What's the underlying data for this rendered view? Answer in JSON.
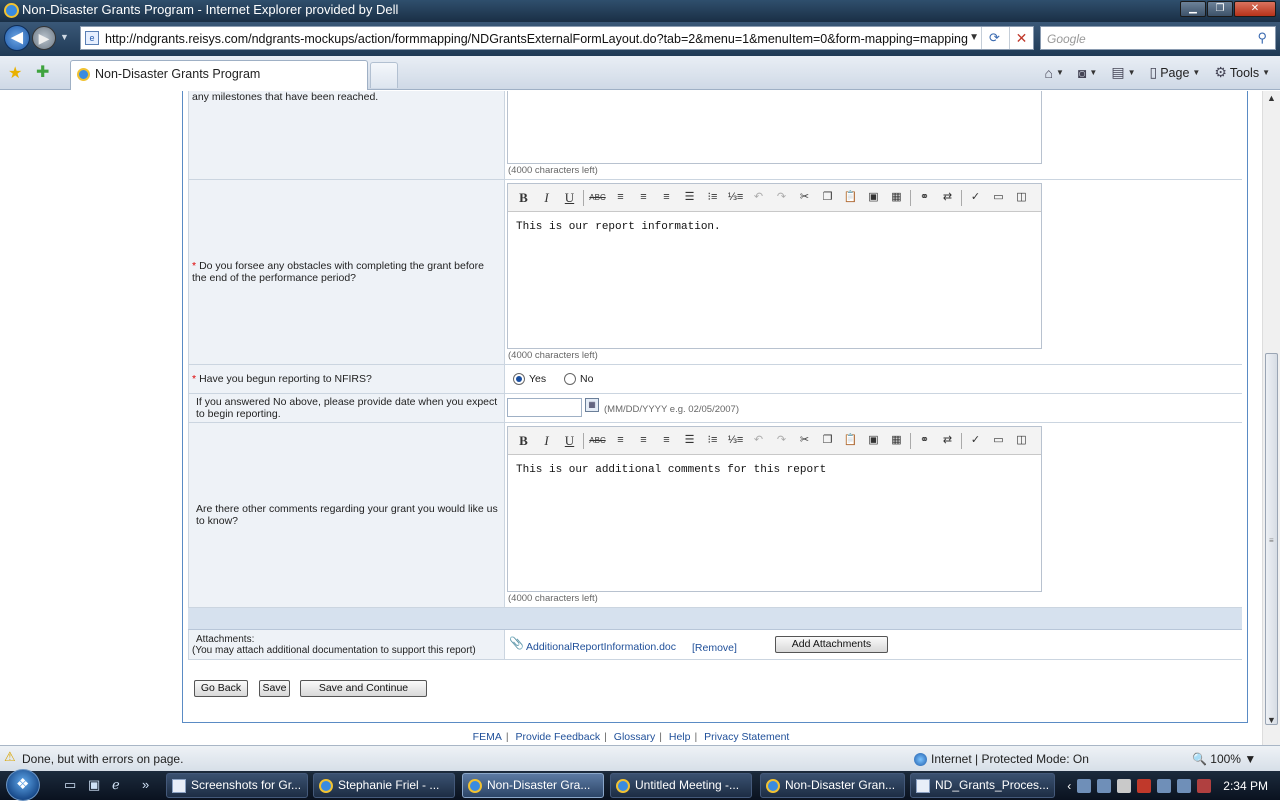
{
  "window": {
    "title": "Non-Disaster Grants Program - Internet Explorer provided by Dell",
    "buttons": {
      "minimize": "▁",
      "maximize": "❐",
      "close": "✕"
    }
  },
  "navbar": {
    "url": "http://ndgrants.reisys.com/ndgrants-mockups/action/formmapping/NDGrantsExternalFormLayout.do?tab=2&menu=1&menuItem=0&form-mapping=mapping",
    "search_placeholder": "Google"
  },
  "tabbar": {
    "tab_title": "Non-Disaster Grants Program",
    "commands": {
      "page": "Page",
      "tools": "Tools"
    }
  },
  "form": {
    "milestones_tail": "any milestones that have been reached.",
    "chars_left": "(4000 characters left)",
    "q_obstacles": "Do you forsee any obstacles with completing the grant before the end of the performance period?",
    "a_obstacles": "This is our report information.",
    "q_nfirs": "Have you begun reporting to NFIRS?",
    "nfirs_yes": "Yes",
    "nfirs_no": "No",
    "q_expect_date": "If you answered No above, please provide date when you expect to begin reporting.",
    "date_hint": "(MM/DD/YYYY e.g. 02/05/2007)",
    "q_comments": "Are there other comments regarding your grant you would like us to know?",
    "a_comments": "This is our additional comments for this report",
    "attachments_label": "Attachments:",
    "attachments_sub": "(You may attach additional documentation to support this report)",
    "attachment_file": "AdditionalReportInformation.doc",
    "remove_link": "[Remove]",
    "add_attachments": "Add Attachments",
    "go_back": "Go Back",
    "save": "Save",
    "save_continue": "Save and Continue"
  },
  "footer": {
    "links": [
      "FEMA",
      "Provide Feedback",
      "Glossary",
      "Help",
      "Privacy Statement"
    ]
  },
  "statusbar": {
    "status": "Done, but with errors on page.",
    "zone": "Internet | Protected Mode: On",
    "zoom": "100%"
  },
  "taskbar": {
    "tasks": [
      "Screenshots for Gr...",
      "Stephanie Friel - ...",
      "Non-Disaster Gra...",
      "Untitled Meeting -...",
      "Non-Disaster Gran...",
      "ND_Grants_Proces..."
    ],
    "clock": "2:34 PM"
  }
}
